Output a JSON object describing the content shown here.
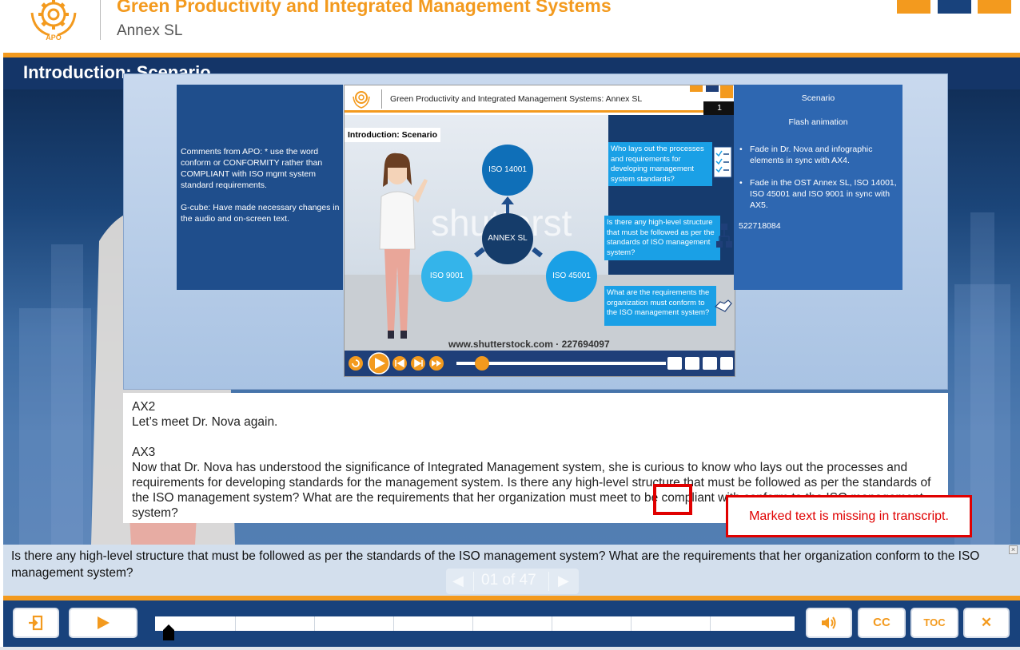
{
  "header": {
    "title": "Green Productivity and Integrated Management Systems",
    "subtitle": "Annex SL",
    "logo_text": "APO"
  },
  "slide": {
    "title": "Introduction: Scenario"
  },
  "comments_panel": {
    "para1": "Comments from APO: * use the word conform or CONFORMITY rather than COMPLIANT with ISO mgmt system standard requirements.",
    "para2": "G-cube: Have made necessary changes in the audio and on-screen text."
  },
  "notes_panel": {
    "title": "Scenario",
    "subtitle": "Flash animation",
    "bullets": [
      "Fade in Dr. Nova and infographic elements in sync with AX4.",
      "Fade in the OST Annex SL, ISO 14001, ISO 45001 and ISO 9001 in sync with AX5."
    ],
    "code": "522718084"
  },
  "mini_slide": {
    "title": "Green Productivity and Integrated Management Systems: Annex SL",
    "page_number": "1",
    "label": "Introduction: Scenario",
    "watermark": "shutterst",
    "watermark_footer": "www.shutterstock.com · 227694097",
    "circles": {
      "top": "ISO 14001",
      "center": "ANNEX SL",
      "left": "ISO 9001",
      "right": "ISO 45001"
    },
    "questions": [
      "Who lays out the processes and requirements for developing management system standards?",
      "Is there any high-level structure that must be followed as per the standards of ISO management system?",
      "What are the requirements the organization must conform to the ISO management system?"
    ]
  },
  "transcript": {
    "lines": [
      "AX2",
      "Let’s meet Dr. Nova again.",
      "",
      "AX3",
      "Now that Dr. Nova has understood the significance of Integrated Management system, she is curious to know who lays out the processes and requirements for developing standards for the management system. Is there any high-level structure that must be followed as per the standards of the ISO management system? What are the requirements that her organization must meet to be compliant with conform to the ISO management system?"
    ]
  },
  "review_note": "Marked text is missing in transcript.",
  "caption": {
    "text": "Is there any high-level structure that must be followed as per the standards of the ISO management system? What are the requirements that her organization conform to the ISO management system?",
    "close_label": "×"
  },
  "pager": {
    "text": "01 of 47",
    "prev": "◀",
    "next": "▶"
  },
  "controls": {
    "exit_icon": "exit-icon",
    "play_icon": "play-icon",
    "volume_icon": "volume-icon",
    "cc_label": "CC",
    "toc_label": "TOC",
    "close_label": "✕",
    "progress": 0.02
  },
  "colors": {
    "accent": "#f39a1e",
    "navy": "#18427c",
    "title_bar": "#143568",
    "error": "#e00000",
    "circle_dark": "#0f6fb8",
    "circle_light": "#34b4ea"
  }
}
